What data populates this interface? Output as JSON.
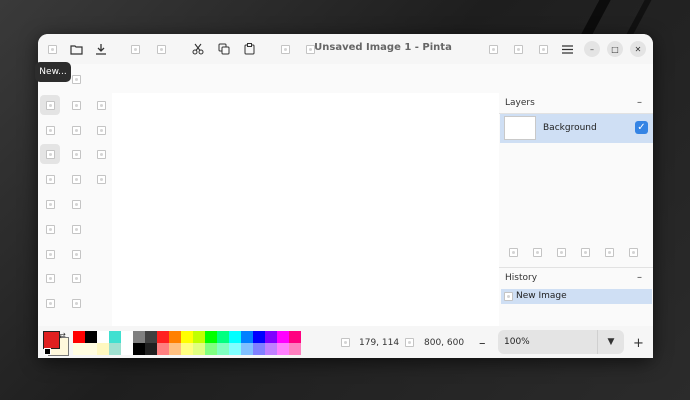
{
  "window": {
    "title": "Unsaved Image 1 - Pinta",
    "tooltip": "New..."
  },
  "icons": {
    "new": "new-file-icon",
    "open": "open-folder-icon",
    "save": "download-icon",
    "cut": "scissors-icon",
    "copy": "copy-icon",
    "paste": "clipboard-icon",
    "menu": "hamburger-menu-icon",
    "minimize": "minimize-icon",
    "maximize": "maximize-icon",
    "close": "close-icon",
    "check": "checkmark-icon"
  },
  "window_controls": {
    "minimize": "–",
    "maximize": "□",
    "close": "✕"
  },
  "layers": {
    "title": "Layers",
    "collapse": "–",
    "items": [
      {
        "name": "Background",
        "visible": true
      }
    ]
  },
  "history": {
    "title": "History",
    "collapse": "–",
    "items": [
      {
        "name": "New Image"
      }
    ]
  },
  "status": {
    "cursor_position": "179, 114",
    "image_size": "800, 600"
  },
  "zoom": {
    "value": "100%",
    "dropdown_glyph": "▼",
    "minus": "–",
    "plus": "+"
  },
  "colors": {
    "accent": "#3584e4",
    "selection": "#cfdff4",
    "primary": "#e02020",
    "secondary": "#fff8dc",
    "palette_top": [
      "#ff0000",
      "#000000",
      "#ffffff",
      "#40e0d0",
      "#ffffff",
      "#808080",
      "#404040",
      "#ff2020",
      "#ff8000",
      "#ffff00",
      "#c0ff00",
      "#00ff00",
      "#00ff80",
      "#00ffff",
      "#0080ff",
      "#0000ff",
      "#8000ff",
      "#ff00ff",
      "#ff0080"
    ],
    "palette_bottom": [
      "#fffce0",
      "#fffce0",
      "#fff8c0",
      "#a0e0d0",
      "#ffffff",
      "#000000",
      "#202020",
      "#ff8080",
      "#ffc080",
      "#ffff80",
      "#e0ff80",
      "#80ff80",
      "#80ffc0",
      "#80ffff",
      "#80c0ff",
      "#8080ff",
      "#c080ff",
      "#ff80ff",
      "#ff80c0"
    ]
  }
}
